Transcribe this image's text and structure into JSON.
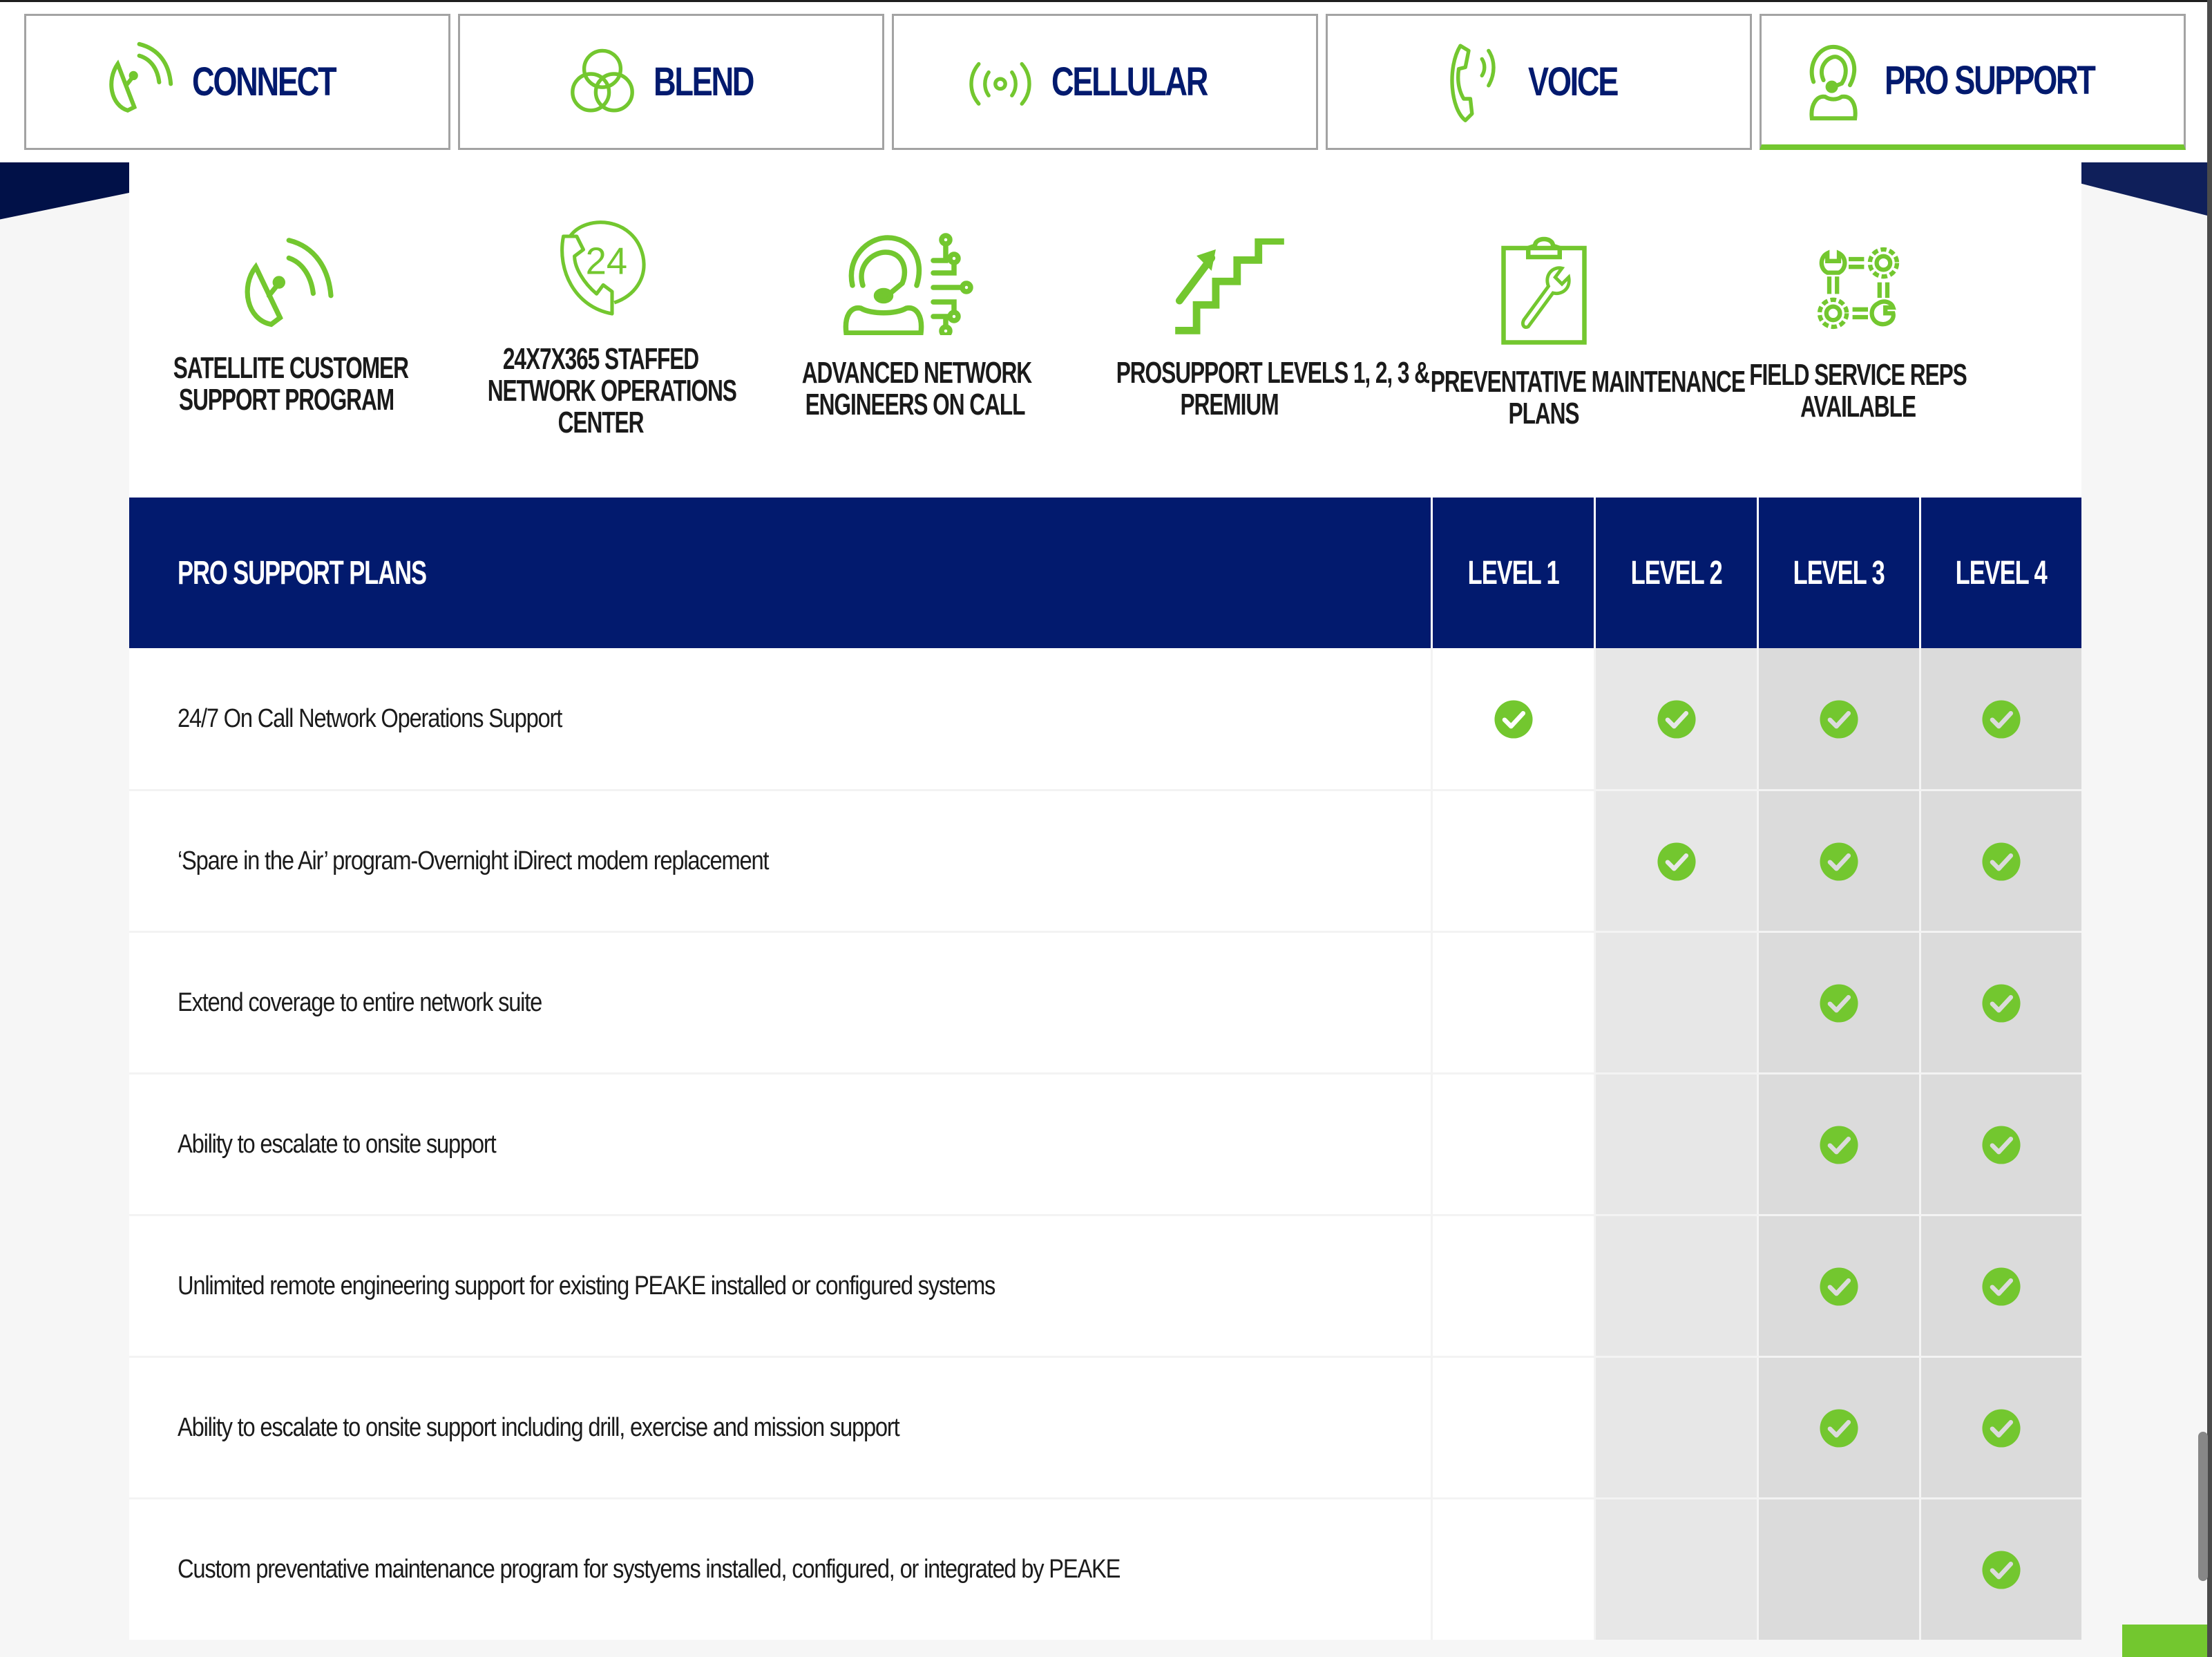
{
  "colors": {
    "brand_navy": "#021a6e",
    "brand_green": "#73c72f",
    "tab_border": "#a3a3a3",
    "level2_bg": "#e7e7e7",
    "level34_bg": "#dbdbdb"
  },
  "tabs": [
    {
      "label": "CONNECT",
      "icon": "satellite-dish-icon",
      "active": false
    },
    {
      "label": "BLEND",
      "icon": "venn-circles-icon",
      "active": false
    },
    {
      "label": "CELLULAR",
      "icon": "broadcast-signal-icon",
      "active": false
    },
    {
      "label": "VOICE",
      "icon": "phone-ringing-icon",
      "active": false
    },
    {
      "label": "PRO SUPPORT",
      "icon": "headset-agent-icon",
      "active": true
    }
  ],
  "features": [
    {
      "lines": [
        "SATELLITE CUSTOMER",
        "SUPPORT PROGRAM"
      ],
      "icon": "satellite-dish-icon"
    },
    {
      "lines": [
        "24X7X365 STAFFED",
        "NETWORK OPERATIONS",
        "CENTER"
      ],
      "icon": "phone-24-hours-icon"
    },
    {
      "lines": [
        "ADVANCED NETWORK",
        "ENGINEERS ON CALL"
      ],
      "icon": "headset-engineer-circuit-icon"
    },
    {
      "lines": [
        "PROSUPPORT LEVELS 1, 2, 3 &",
        "PREMIUM"
      ],
      "icon": "stairs-arrow-up-icon"
    },
    {
      "lines": [
        "PREVENTATIVE MAINTENANCE",
        "PLANS"
      ],
      "icon": "clipboard-wrench-icon"
    },
    {
      "lines": [
        "FIELD SERVICE REPS",
        "AVAILABLE"
      ],
      "icon": "gears-wrenches-icon"
    }
  ],
  "table": {
    "header": "PRO SUPPORT PLANS",
    "levels": [
      "LEVEL 1",
      "LEVEL 2",
      "LEVEL 3",
      "LEVEL 4"
    ],
    "rows": [
      {
        "feature": "24/7 On Call Network Operations Support",
        "included": [
          true,
          true,
          true,
          true
        ]
      },
      {
        "feature": "‘Spare in the Air’ program-Overnight iDirect modem replacement",
        "included": [
          false,
          true,
          true,
          true
        ]
      },
      {
        "feature": "Extend coverage to entire network suite",
        "included": [
          false,
          false,
          true,
          true
        ]
      },
      {
        "feature": "Ability to escalate to onsite support",
        "included": [
          false,
          false,
          true,
          true
        ]
      },
      {
        "feature": "Unlimited remote engineering support for existing PEAKE installed or configured systems",
        "included": [
          false,
          false,
          true,
          true
        ]
      },
      {
        "feature": "Ability to escalate to onsite support including drill, exercise and mission support",
        "included": [
          false,
          false,
          true,
          true
        ]
      },
      {
        "feature": "Custom preventative maintenance program for systyems installed, configured, or integrated by PEAKE",
        "included": [
          false,
          false,
          false,
          true
        ]
      }
    ]
  }
}
